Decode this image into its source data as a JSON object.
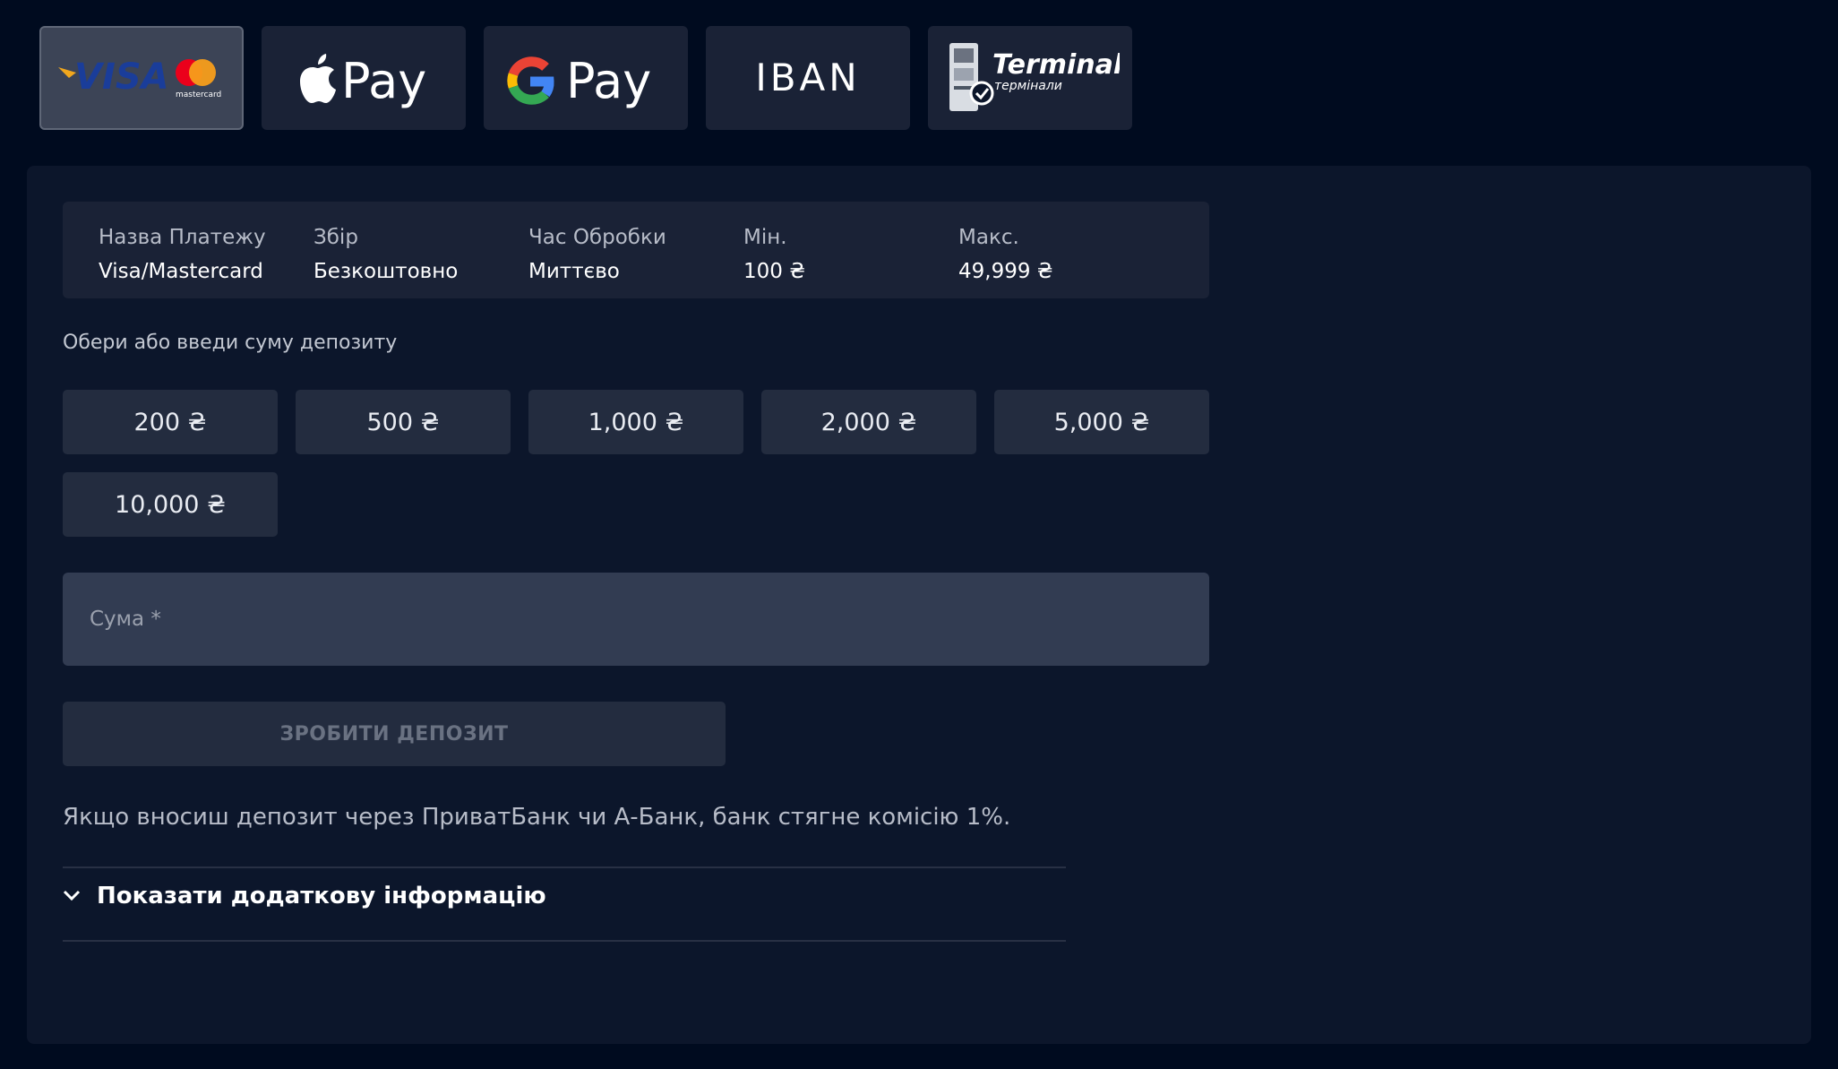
{
  "methods": [
    {
      "name": "Visa / Mastercard",
      "visa_text": "VISA",
      "mc_text": "mastercard",
      "active": true
    },
    {
      "name": "Apple Pay",
      "text": "Pay"
    },
    {
      "name": "Google Pay",
      "text": "Pay"
    },
    {
      "name": "IBAN",
      "text": "IBAN"
    },
    {
      "name": "Terminals",
      "text": "Terminals",
      "subtext": "термінали"
    }
  ],
  "info": {
    "payment_name_label": "Назва Платежу",
    "payment_name_value": "Visa/Mastercard",
    "fee_label": "Збір",
    "fee_value": "Безкоштовно",
    "time_label": "Час Обробки",
    "time_value": "Миттєво",
    "min_label": "Мін.",
    "min_value": "100 ₴",
    "max_label": "Макс.",
    "max_value": "49,999 ₴"
  },
  "choose_label": "Обери або введи суму депозиту",
  "amounts": [
    "200 ₴",
    "500 ₴",
    "1,000 ₴",
    "2,000 ₴",
    "5,000 ₴",
    "10,000 ₴"
  ],
  "sum_input": {
    "placeholder": "Сума *",
    "value": ""
  },
  "deposit_button": "ЗРОБИТИ ДЕПОЗИТ",
  "notice": "Якщо вносиш депозит через ПриватБанк чи А-Банк, банк стягне комісію 1%.",
  "more_info": "Показати додаткову інформацію",
  "colors": {
    "background": "#000b1f",
    "panel": "#0c162b",
    "tile": "#1a2236",
    "visa_blue": "#1a3d9a",
    "visa_gold": "#f1a71d"
  }
}
